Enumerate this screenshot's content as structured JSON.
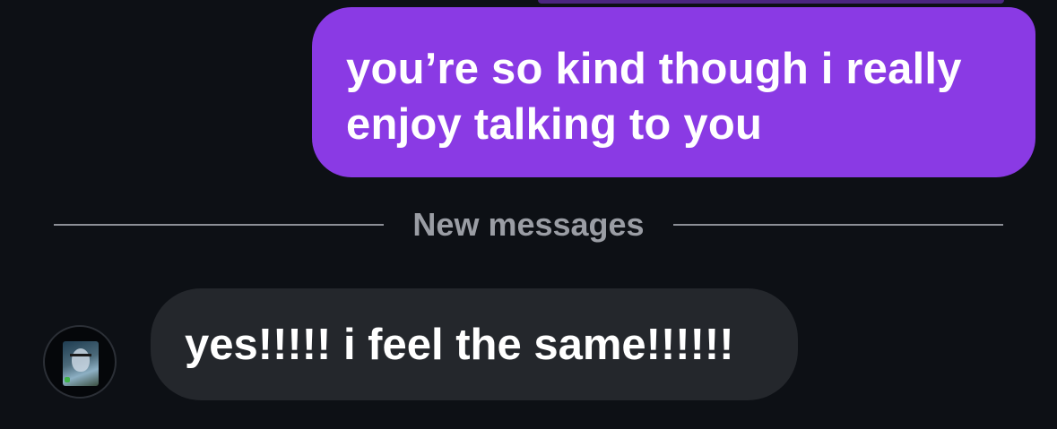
{
  "conversation": {
    "outgoing_message": "you’re so kind though i really enjoy talking to you",
    "divider_label": "New messages",
    "incoming_message": "yes!!!!! i feel the same!!!!!!"
  },
  "colors": {
    "background": "#0d1015",
    "outgoing_bubble": "#8a3ae4",
    "incoming_bubble": "#24272c",
    "divider": "#8c8f96"
  },
  "icons": {
    "avatar": "profile-photo"
  }
}
